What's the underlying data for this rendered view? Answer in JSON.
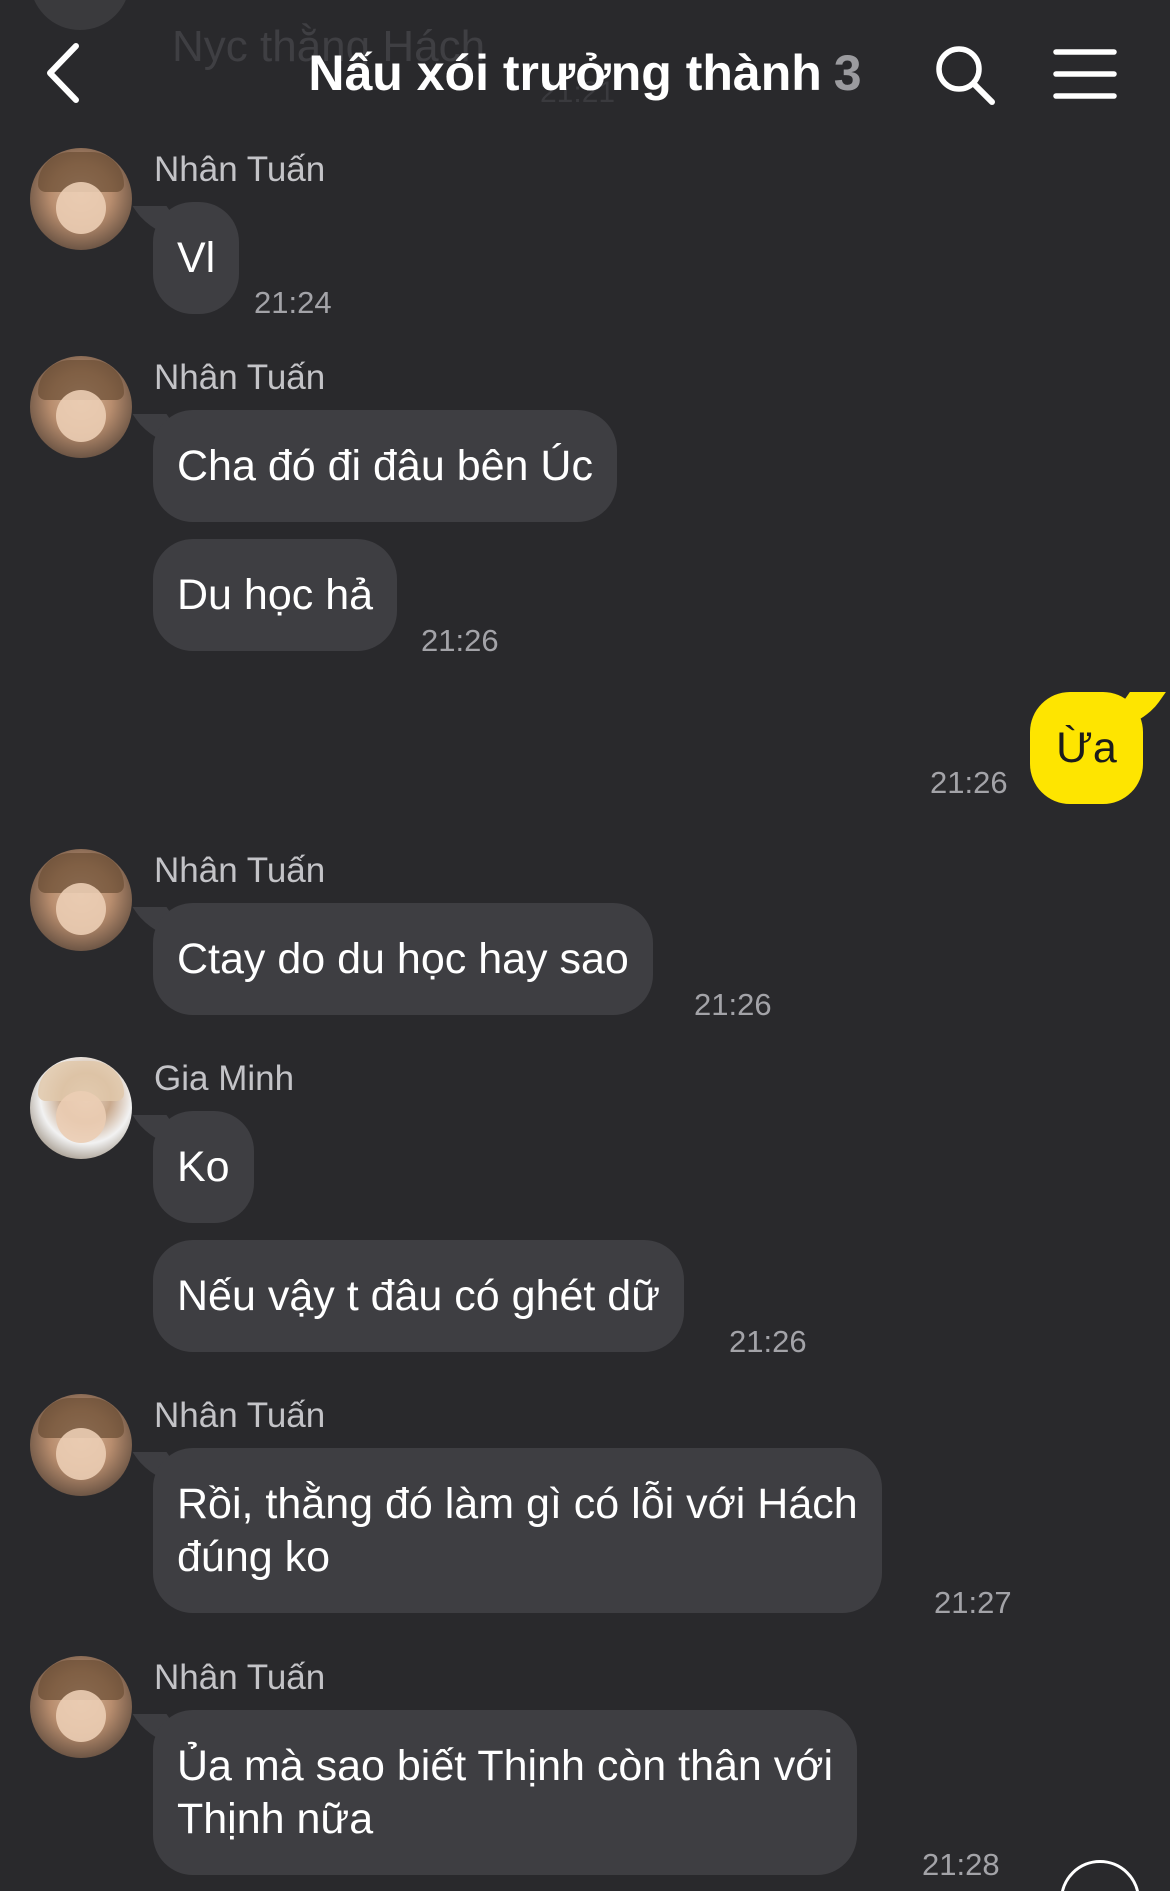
{
  "header": {
    "title": "Nấu xói trưởng thành",
    "member_count": "3",
    "ghost_text": "Nyc thằng Hách",
    "ghost_time": "21:21"
  },
  "messages": [
    {
      "sender": "Nhân Tuấn",
      "text": "Vl",
      "time": "21:24"
    },
    {
      "sender": "Nhân Tuấn",
      "text": "Cha đó đi đâu bên Úc"
    },
    {
      "text": "Du học hả",
      "time": "21:26"
    },
    {
      "mine": true,
      "text": "Ừa",
      "time": "21:26"
    },
    {
      "sender": "Nhân Tuấn",
      "text": "Ctay do du học hay sao",
      "time": "21:26"
    },
    {
      "sender": "Gia Minh",
      "text": "Ko"
    },
    {
      "text": "Nếu vậy t đâu có ghét dữ",
      "time": "21:26"
    },
    {
      "sender": "Nhân Tuấn",
      "text_line1": "Rồi, thằng đó làm gì có lỗi với Hách",
      "text_line2": "đúng ko",
      "time": "21:27"
    },
    {
      "sender": "Nhân Tuấn",
      "text_line1": "Ủa mà sao biết Thịnh còn thân với",
      "text_line2": "Thịnh nữa",
      "time": "21:28"
    }
  ],
  "colors": {
    "background": "#29292c",
    "incoming_bubble": "#3e3e42",
    "outgoing_bubble": "#fee500",
    "timestamp": "#a3a3a8"
  },
  "icons": {
    "back": "back-arrow-icon",
    "search": "search-icon",
    "menu": "hamburger-menu-icon"
  }
}
